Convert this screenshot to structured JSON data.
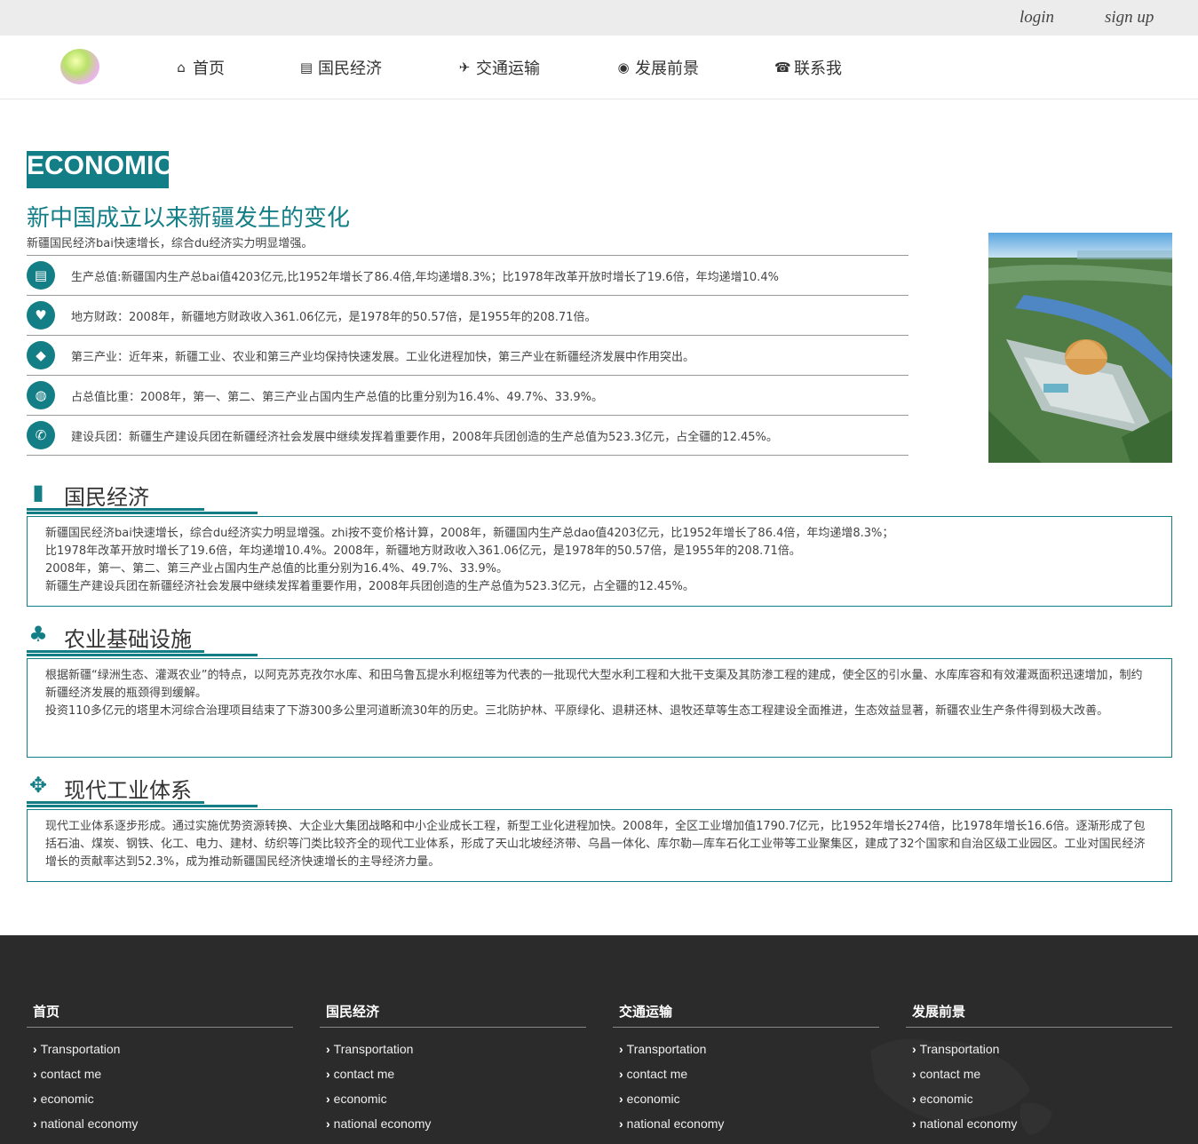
{
  "topbar": {
    "login": "login",
    "signup": "sign up"
  },
  "nav": [
    {
      "icon": "home-icon",
      "glyph": "⌂",
      "label": "首页"
    },
    {
      "icon": "money-icon",
      "glyph": "▤",
      "label": "国民经济"
    },
    {
      "icon": "plane-icon",
      "glyph": "✈",
      "label": "交通运输"
    },
    {
      "icon": "eye-icon",
      "glyph": "◉",
      "label": "发展前景"
    },
    {
      "icon": "phone-icon",
      "glyph": "☎",
      "label": "联系我"
    }
  ],
  "hero": {
    "label": "ECONOMIC",
    "title": "新中国成立以来新疆发生的变化",
    "subtitle": "新疆国民经济bai快速增长，综合du经济实力明显增强。",
    "items": [
      {
        "icon": "document-icon",
        "glyph": "▤",
        "text": "生产总值:新疆国内生产总bai值4203亿元,比1952年增长了86.4倍,年均递增8.3%；比1978年改革开放时增长了19.6倍，年均递增10.4%"
      },
      {
        "icon": "heart-icon",
        "glyph": "♥",
        "text": "地方财政：2008年，新疆地方财政收入361.06亿元，是1978年的50.57倍，是1955年的208.71倍。"
      },
      {
        "icon": "tags-icon",
        "glyph": "◆",
        "text": "第三产业：近年来，新疆工业、农业和第三产业均保持快速发展。工业化进程加快，第三产业在新疆经济发展中作用突出。"
      },
      {
        "icon": "globe-icon",
        "glyph": "◍",
        "text": "占总值比重：2008年，第一、第二、第三产业占国内生产总值的比重分别为16.4%、49.7%、33.9%。"
      },
      {
        "icon": "phone-icon",
        "glyph": "✆",
        "text": "建设兵团：新疆生产建设兵团在新疆经济社会发展中继续发挥着重要作用，2008年兵团创造的生产总值为523.3亿元，占全疆的12.45%。"
      }
    ]
  },
  "sections": [
    {
      "icon": "book-icon",
      "glyph": "▮",
      "title": "国民经济",
      "lines": [
        "新疆国民经济bai快速增长，综合du经济实力明显增强。zhi按不变价格计算，2008年，新疆国内生产总dao值4203亿元，比1952年增长了86.4倍，年均递增8.3%；",
        "比1978年改革开放时增长了19.6倍，年均递增10.4%。2008年，新疆地方财政收入361.06亿元，是1978年的50.57倍，是1955年的208.71倍。",
        "2008年，第一、第二、第三产业占国内生产总值的比重分别为16.4%、49.7%、33.9%。",
        "新疆生产建设兵团在新疆经济社会发展中继续发挥着重要作用，2008年兵团创造的生产总值为523.3亿元，占全疆的12.45%。"
      ]
    },
    {
      "icon": "tree-icon",
      "glyph": "♣",
      "title": "农业基础设施",
      "lines": [
        "根据新疆“绿洲生态、灌溉农业”的特点，以阿克苏克孜尔水库、和田乌鲁瓦提水利枢纽等为代表的一批现代大型水利工程和大批干支渠及其防渗工程的建成，使全区的引水量、水库库容和有效灌溉面积迅速增加，制约新疆经济发展的瓶颈得到缓解。",
        "投资110多亿元的塔里木河综合治理项目结束了下游300多公里河道断流30年的历史。三北防护林、平原绿化、退耕还林、退牧还草等生态工程建设全面推进，生态效益显著，新疆农业生产条件得到极大改善。"
      ]
    },
    {
      "icon": "gear-icon",
      "glyph": "✥",
      "title": "现代工业体系",
      "lines": [
        "现代工业体系逐步形成。通过实施优势资源转换、大企业大集团战略和中小企业成长工程，新型工业化进程加快。2008年，全区工业增加值1790.7亿元，比1952年增长274倍，比1978年增长16.6倍。逐渐形成了包括石油、煤炭、钢铁、化工、电力、建材、纺织等门类比较齐全的现代工业体系，形成了天山北坡经济带、乌昌一体化、库尔勒—库车石化工业带等工业聚集区，建成了32个国家和自治区级工业园区。工业对国民经济增长的贡献率达到52.3%，成为推动新疆国民经济快速增长的主导经济力量。"
      ]
    }
  ],
  "footer": [
    {
      "title": "首页",
      "links": [
        "Transportation",
        "contact me",
        "economic",
        "national economy"
      ]
    },
    {
      "title": "国民经济",
      "links": [
        "Transportation",
        "contact me",
        "economic",
        "national economy"
      ]
    },
    {
      "title": "交通运输",
      "links": [
        "Transportation",
        "contact me",
        "economic",
        "national economy"
      ]
    },
    {
      "title": "发展前景",
      "links": [
        "Transportation",
        "contact me",
        "economic",
        "national economy"
      ]
    }
  ],
  "colors": {
    "accent": "#137e85",
    "footer_bg": "#2b2b2b",
    "topbar_bg": "#ececec"
  }
}
